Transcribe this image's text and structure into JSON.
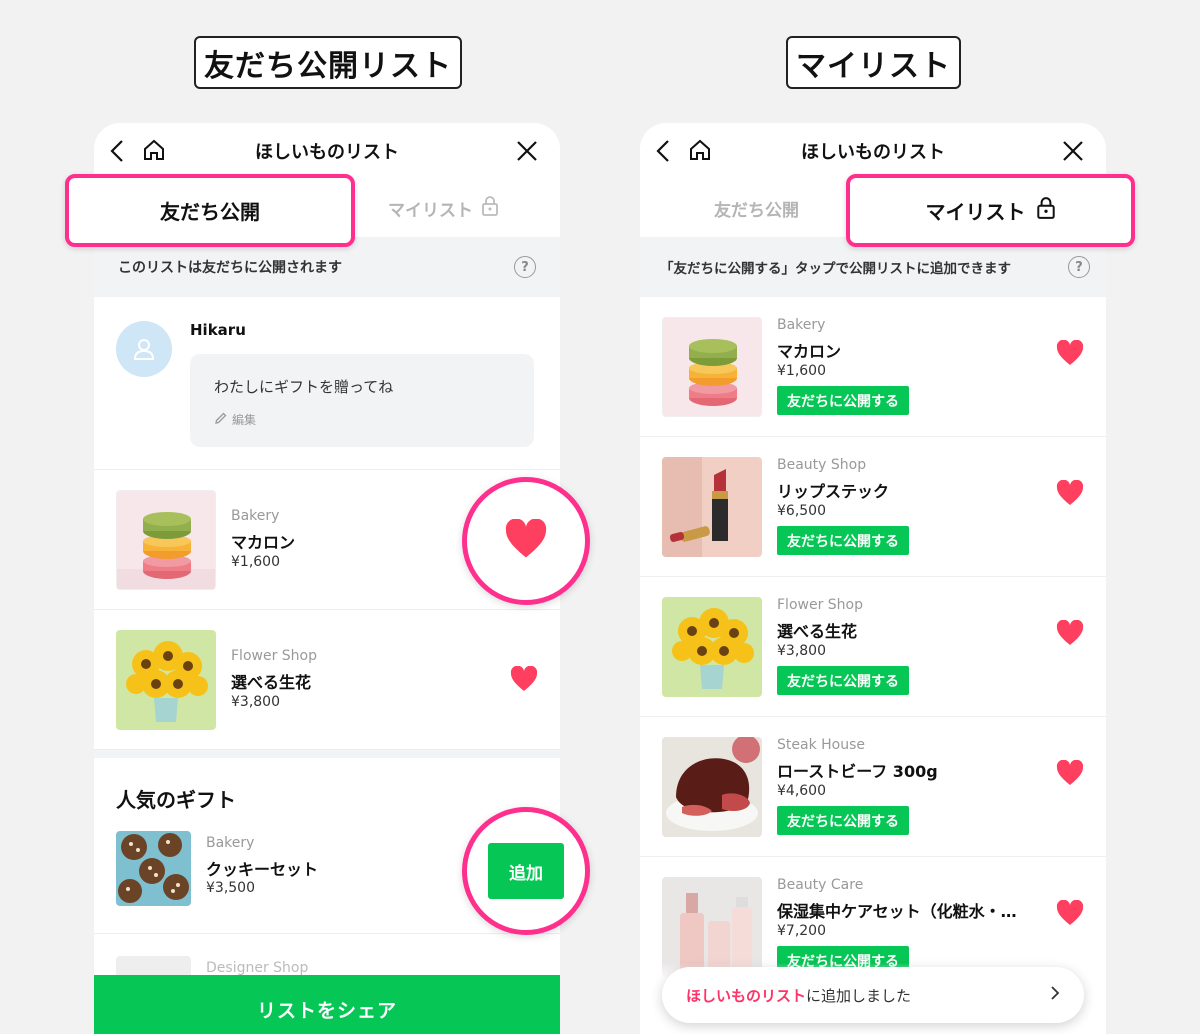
{
  "labels": {
    "left": "友だち公開リスト",
    "right": "マイリスト"
  },
  "nav": {
    "title": "ほしいものリスト"
  },
  "tabs": {
    "public": "友だち公開",
    "mylist": "マイリスト"
  },
  "left": {
    "info": "このリストは友だちに公開されます",
    "profile": {
      "name": "Hikaru",
      "message": "わたしにギフトを贈ってね",
      "edit": "編集"
    },
    "items": [
      {
        "shop": "Bakery",
        "name": "マカロン",
        "price": "¥1,600"
      },
      {
        "shop": "Flower Shop",
        "name": "選べる生花",
        "price": "¥3,800"
      }
    ],
    "popular": {
      "title": "人気のギフト",
      "item": {
        "shop": "Bakery",
        "name": "クッキーセット",
        "price": "¥3,500",
        "add_label": "追加"
      },
      "next_shop": "Designer Shop"
    },
    "share_label": "リストをシェア"
  },
  "right": {
    "info": "「友だちに公開する」タップで公開リストに追加できます",
    "publish_label": "友だちに公開する",
    "items": [
      {
        "shop": "Bakery",
        "name": "マカロン",
        "price": "¥1,600"
      },
      {
        "shop": "Beauty Shop",
        "name": "リップステック",
        "price": "¥6,500"
      },
      {
        "shop": "Flower Shop",
        "name": "選べる生花",
        "price": "¥3,800"
      },
      {
        "shop": "Steak House",
        "name": "ローストビーフ 300g",
        "price": "¥4,600"
      },
      {
        "shop": "Beauty Care",
        "name": "保湿集中ケアセット（化粧水・…",
        "price": "¥7,200"
      }
    ],
    "toast": {
      "highlight": "ほしいものリスト",
      "rest": "に追加しました"
    }
  },
  "colors": {
    "accent_green": "#06c755",
    "highlight_pink": "#ff2f8d",
    "heart": "#ff3f5f"
  }
}
